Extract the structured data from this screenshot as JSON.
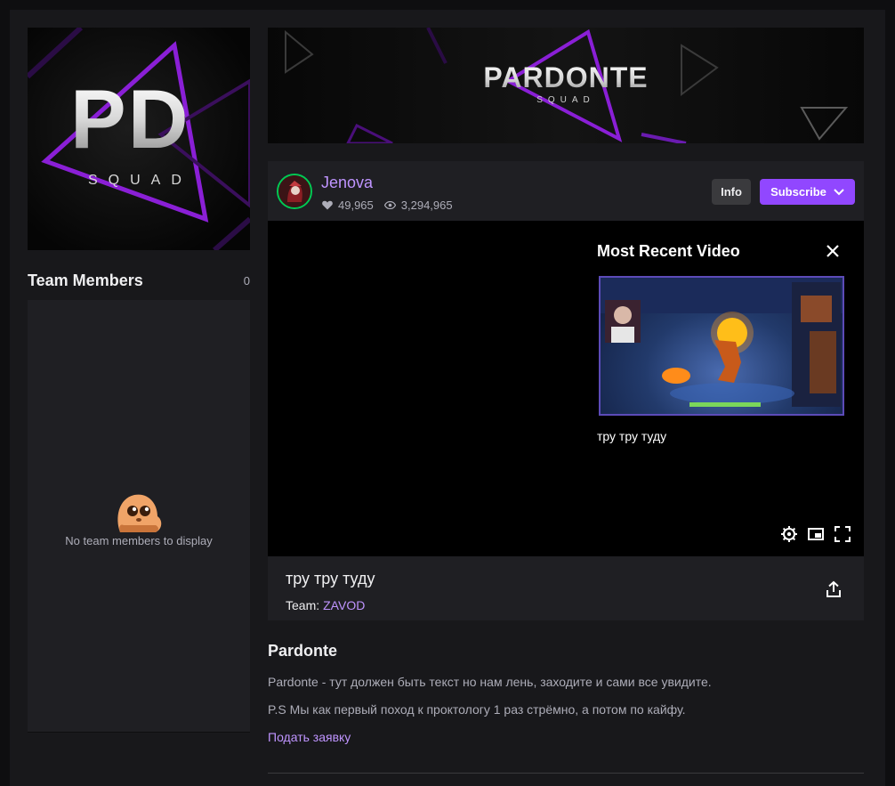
{
  "colors": {
    "background": "#0e0e10",
    "panel": "#1f1f23",
    "accent": "#9147ff",
    "link": "#bf94ff",
    "live_ring": "#00c853"
  },
  "team_logo": {
    "letters": "PD",
    "squad": "SQUAD"
  },
  "members": {
    "title": "Team Members",
    "count": "0",
    "empty_text": "No team members to display",
    "empty_icon": "sad-emote-icon"
  },
  "banner": {
    "title": "PARDONTE",
    "subtitle": "SQUAD"
  },
  "channel": {
    "name": "Jenova",
    "followers": "49,965",
    "views": "3,294,965",
    "info_label": "Info",
    "subscribe_label": "Subscribe"
  },
  "player": {
    "recent_title": "Most Recent Video",
    "recent_caption": "тру тру туду",
    "controls": [
      "gear-icon",
      "picture-in-picture-icon",
      "fullscreen-icon"
    ]
  },
  "stream": {
    "title": "тру тру туду",
    "team_label": "Team:",
    "team_name": "ZAVOD"
  },
  "about": {
    "title": "Pardonte",
    "line1": "Pardonte - тут должен быть текст но нам лень, заходите и сами все увидите.",
    "line2": "P.S Мы как первый поход к проктологу 1 раз стрёмно, а потом по кайфу.",
    "link": "Подать заявку"
  }
}
